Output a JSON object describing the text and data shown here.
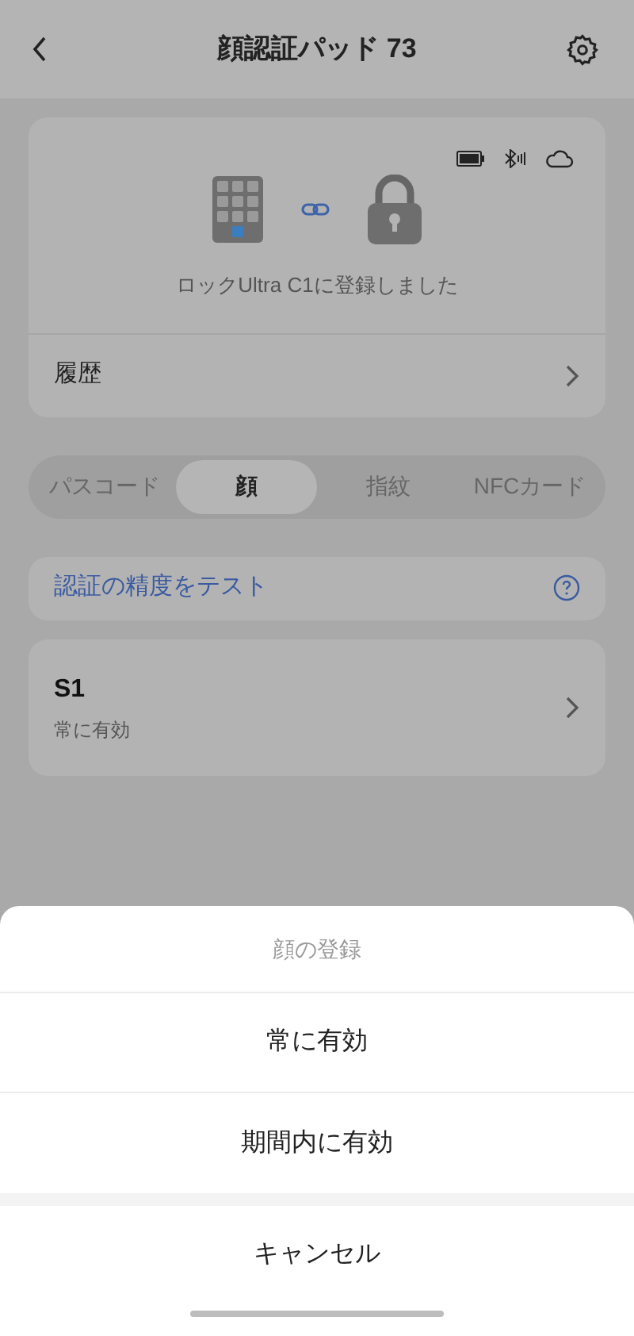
{
  "header": {
    "title": "顔認証パッド 73"
  },
  "device_card": {
    "caption": "ロックUltra C1に登録しました",
    "history_label": "履歴"
  },
  "tabs": [
    {
      "label": "パスコード",
      "selected": false
    },
    {
      "label": "顔",
      "selected": true
    },
    {
      "label": "指紋",
      "selected": false
    },
    {
      "label": "NFCカード",
      "selected": false
    }
  ],
  "test_link": {
    "label": "認証の精度をテスト"
  },
  "entries": [
    {
      "name": "S1",
      "validity": "常に有効"
    }
  ],
  "sheet": {
    "title": "顔の登録",
    "options": [
      "常に有効",
      "期間内に有効"
    ],
    "cancel": "キャンセル"
  }
}
